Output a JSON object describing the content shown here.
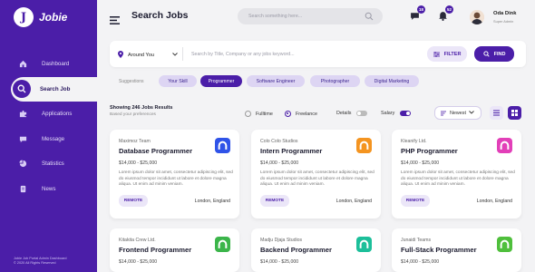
{
  "app": {
    "logo_letter": "J",
    "name": "Jobie",
    "footer_line1": "Jobie Job Portal Admin Dashboard",
    "footer_line2": "© 2020 All Rights Reserved"
  },
  "sidebar": {
    "items": [
      {
        "label": "Dashboard",
        "icon": "home-icon",
        "active": false
      },
      {
        "label": "Search Job",
        "icon": "search-icon",
        "active": true
      },
      {
        "label": "Applications",
        "icon": "puzzle-icon",
        "active": false
      },
      {
        "label": "Message",
        "icon": "chat-icon",
        "active": false
      },
      {
        "label": "Statistics",
        "icon": "pie-chart-icon",
        "active": false
      },
      {
        "label": "News",
        "icon": "document-icon",
        "active": false
      }
    ]
  },
  "header": {
    "title": "Search Jobs",
    "search_placeholder": "Search something here...",
    "messages_badge": "18",
    "notifications_badge": "52",
    "user_name": "Oda Dink",
    "user_role": "Super Admin"
  },
  "search": {
    "location": "Around You",
    "keyword_placeholder": "Search by Title, Company or any jobs keyword...",
    "filter_label": "FILTER",
    "find_label": "FIND"
  },
  "suggestions": {
    "label": "Suggestions",
    "chips": [
      "Your Skill",
      "Programmer",
      "Software Engineer",
      "Photographer",
      "Digital Marketing"
    ]
  },
  "results": {
    "count_text": "Showing 246 Jobs Results",
    "sub_text": "Based your preferences",
    "fulltime": "Fulltime",
    "freelance": "Freelance",
    "details": "Details",
    "salary": "Salary",
    "sort": "Newest"
  },
  "jobs": [
    {
      "company": "Maximoz Team",
      "title": "Database Programmer",
      "salary": "$14,000 - $25,000",
      "desc": "Lorem ipsum dolor sit amet, consectetur adipiscing elit, sed do eiusmod tempor incididunt ut labore et dolore magna aliqua. Ut enim ad minim veniam.",
      "tag": "REMOTE",
      "location": "London, England",
      "logo_color": "#2f53e8"
    },
    {
      "company": "Colo Colo Studios",
      "title": "Intern Programmer",
      "salary": "$14,000 - $25,000",
      "desc": "Lorem ipsum dolor sit amet, consectetur adipiscing elit, sed do eiusmod tempor incididunt ut labore et dolore magna aliqua. Ut enim ad minim veniam.",
      "tag": "REMOTE",
      "location": "London, England",
      "logo_color": "#f49420"
    },
    {
      "company": "Kleanify Ltd.",
      "title": "PHP Programmer",
      "salary": "$14,000 - $25,000",
      "desc": "Lorem ipsum dolor sit amet, consectetur adipiscing elit, sed do eiusmod tempor incididunt ut labore et dolore magna aliqua. Ut enim ad minim veniam.",
      "tag": "REMOTE",
      "location": "London, England",
      "logo_color": "#e23fb8"
    },
    {
      "company": "Kitakita Crew Ltd.",
      "title": "Frontend Programmer",
      "salary": "$14,000 - $25,000",
      "logo_color": "#3bb54a"
    },
    {
      "company": "Madju Djaja Studios",
      "title": "Backend Programmer",
      "salary": "$14,000 - $25,000",
      "logo_color": "#1cbf9a"
    },
    {
      "company": "Junaidi Teams",
      "title": "Full-Stack Programmer",
      "salary": "$14,000 - $25,000",
      "logo_color": "#4fbf3c"
    }
  ]
}
